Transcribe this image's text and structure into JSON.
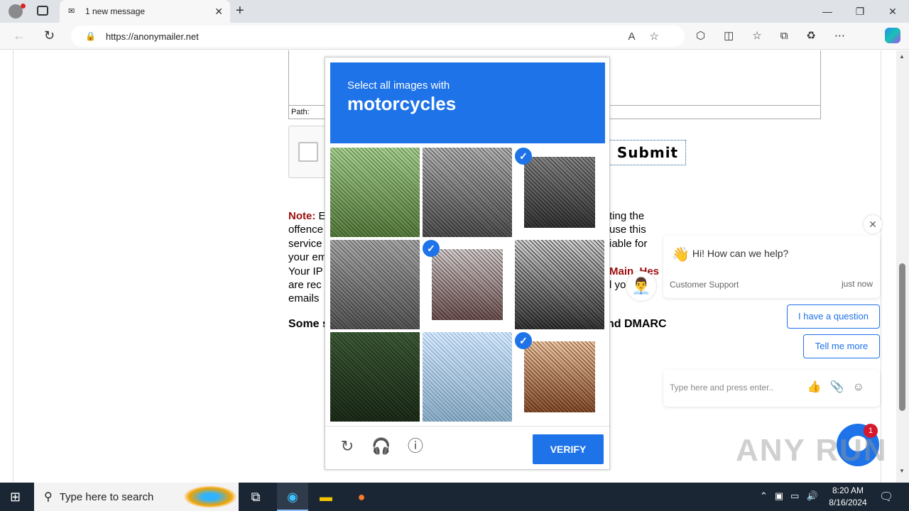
{
  "browser": {
    "tab_title": "1 new message",
    "url": "https://anonymailer.net"
  },
  "page": {
    "path_label": "Path:",
    "submit_label": "Submit",
    "note_label": "Note:",
    "note_left_lines": [
      " E",
      "offence",
      "service",
      "your em",
      "Your IP",
      "are rec",
      "emails"
    ],
    "note_right_lines": [
      "ting the",
      "use this",
      "iable for",
      "",
      "Main_Hes",
      "l yo",
      ""
    ],
    "some_line": "Some s",
    "dmarc_text": "nd DMARC"
  },
  "captcha": {
    "prompt": "Select all images with",
    "target": "motorcycles",
    "tiles": [
      {
        "name": "tile-trees-street",
        "selected": false,
        "colors": [
          "#cfe6c3",
          "#6e8a55"
        ]
      },
      {
        "name": "tile-traffic-road",
        "selected": false,
        "colors": [
          "#d7d7d7",
          "#5f5f5f"
        ]
      },
      {
        "name": "tile-scooter-front",
        "selected": true,
        "colors": [
          "#b9b9b9",
          "#4a4a4a"
        ]
      },
      {
        "name": "tile-bicycle-rider",
        "selected": false,
        "colors": [
          "#d0d0d0",
          "#6a6a6a"
        ]
      },
      {
        "name": "tile-motorcycle-rider",
        "selected": true,
        "colors": [
          "#e7e7e7",
          "#7a5c5c"
        ]
      },
      {
        "name": "tile-crosswalk",
        "selected": false,
        "colors": [
          "#e9e9e9",
          "#3c3c3c"
        ]
      },
      {
        "name": "tile-bridge",
        "selected": false,
        "colors": [
          "#7f9a78",
          "#3a4a36"
        ]
      },
      {
        "name": "tile-houses-poles",
        "selected": false,
        "colors": [
          "#eaf4ff",
          "#9bb6c7"
        ]
      },
      {
        "name": "tile-parked-scooter",
        "selected": true,
        "colors": [
          "#f4e2cf",
          "#8b5a3a"
        ]
      }
    ],
    "verify_label": "VERIFY"
  },
  "chat": {
    "greeting": "Hi! How can we help?",
    "sender": "Customer Support",
    "time": "just now",
    "option_1": "I have a question",
    "option_2": "Tell me more",
    "input_placeholder": "Type here and press enter..",
    "badge_count": "1"
  },
  "watermark": "ANY RUN",
  "taskbar": {
    "search_placeholder": "Type here to search",
    "time": "8:20 AM",
    "date": "8/16/2024"
  }
}
